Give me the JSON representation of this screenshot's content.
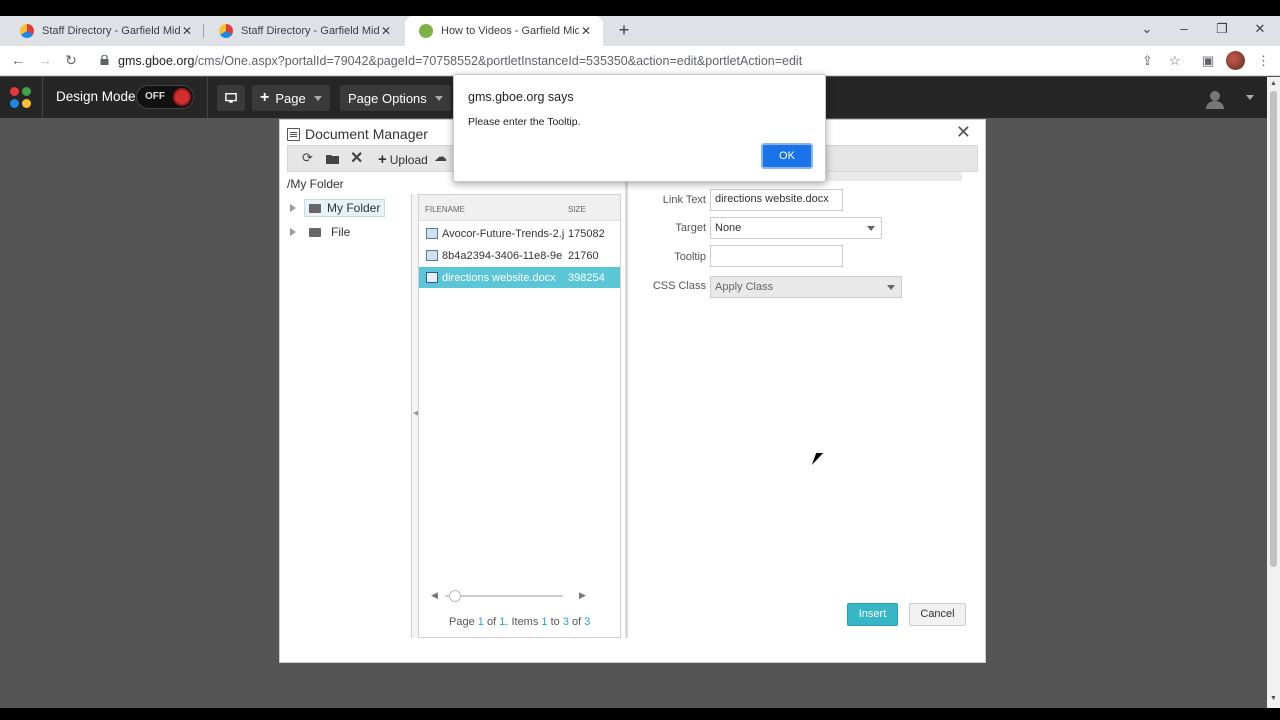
{
  "browser": {
    "tabs": [
      {
        "title": "Staff Directory - Garfield Middle",
        "icon": "site-icon"
      },
      {
        "title": "Staff Directory - Garfield Middle",
        "icon": "site-icon"
      },
      {
        "title": "How to Videos - Garfield Middle",
        "icon": "site-icon-green"
      }
    ],
    "url_host": "gms.gboe.org",
    "url_path": "/cms/One.aspx?portalId=79042&pageId=70758552&portletInstanceId=535350&action=edit&portletAction=edit"
  },
  "cms_toolbar": {
    "design_mode_label": "Design Mode",
    "toggle_label": "OFF",
    "page_button": "Page",
    "page_options_button": "Page Options"
  },
  "document_manager": {
    "title": "Document Manager",
    "upload_label": "Upload",
    "current_path": "/My Folder",
    "tree": [
      {
        "label": "My Folder",
        "selected": true
      },
      {
        "label": "File",
        "selected": false
      }
    ],
    "columns": {
      "filename": "FILENAME",
      "size": "SIZE"
    },
    "files": [
      {
        "name": "Avocor-Future-Trends-2.j",
        "size": "175082"
      },
      {
        "name": "8b4a2394-3406-11e8-9e",
        "size": "21760"
      },
      {
        "name": "directions website.docx",
        "size": "398254"
      }
    ],
    "pager": {
      "page_label": "Page",
      "page": "1",
      "of_label": "of",
      "pages": "1",
      "items_label": "Items",
      "from": "1",
      "to_label": "to",
      "to": "3",
      "total": "3"
    },
    "properties": {
      "link_text_label": "Link Text",
      "link_text_value": "directions website.docx",
      "target_label": "Target",
      "target_value": "None",
      "tooltip_label": "Tooltip",
      "tooltip_value": "",
      "css_class_label": "CSS Class",
      "css_class_value": "Apply Class"
    },
    "insert_button": "Insert",
    "cancel_button": "Cancel"
  },
  "alert": {
    "title": "gms.gboe.org says",
    "message": "Please enter the Tooltip.",
    "ok_button": "OK"
  }
}
